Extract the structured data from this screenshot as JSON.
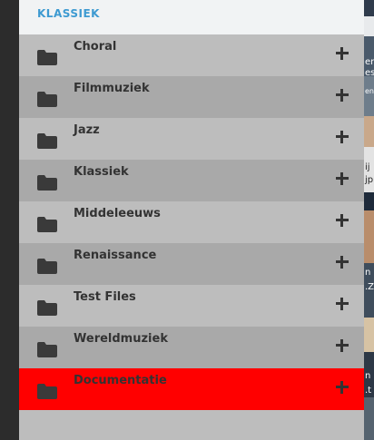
{
  "panel": {
    "title": "KLASSIEK",
    "items": [
      {
        "label": "Choral",
        "icon": "folder-icon",
        "action_icon": "plus-icon",
        "state": "normal"
      },
      {
        "label": "Filmmuziek",
        "icon": "folder-icon",
        "action_icon": "plus-icon",
        "state": "alt"
      },
      {
        "label": "Jazz",
        "icon": "folder-icon",
        "action_icon": "plus-icon",
        "state": "normal"
      },
      {
        "label": "Klassiek",
        "icon": "folder-icon",
        "action_icon": "plus-icon",
        "state": "alt"
      },
      {
        "label": "Middeleeuws",
        "icon": "folder-icon",
        "action_icon": "plus-icon",
        "state": "normal"
      },
      {
        "label": "Renaissance",
        "icon": "folder-icon",
        "action_icon": "plus-icon",
        "state": "alt"
      },
      {
        "label": "Test Files",
        "icon": "folder-icon",
        "action_icon": "plus-icon",
        "state": "normal"
      },
      {
        "label": "Wereldmuziek",
        "icon": "folder-icon",
        "action_icon": "plus-icon",
        "state": "alt"
      },
      {
        "label": "Documentatie",
        "icon": "folder-icon",
        "action_icon": "plus-icon",
        "state": "active"
      }
    ]
  },
  "background_fragments": [
    "en",
    "es",
    "en",
    "ij",
    "jp",
    "n",
    ".Z",
    "n",
    ".t"
  ],
  "colors": {
    "title": "#3d9ad1",
    "row": "#bdbdbd",
    "row_alt": "#a9a9a9",
    "row_active": "#ff0000",
    "text": "#333333",
    "header_bg": "#f1f3f4"
  }
}
